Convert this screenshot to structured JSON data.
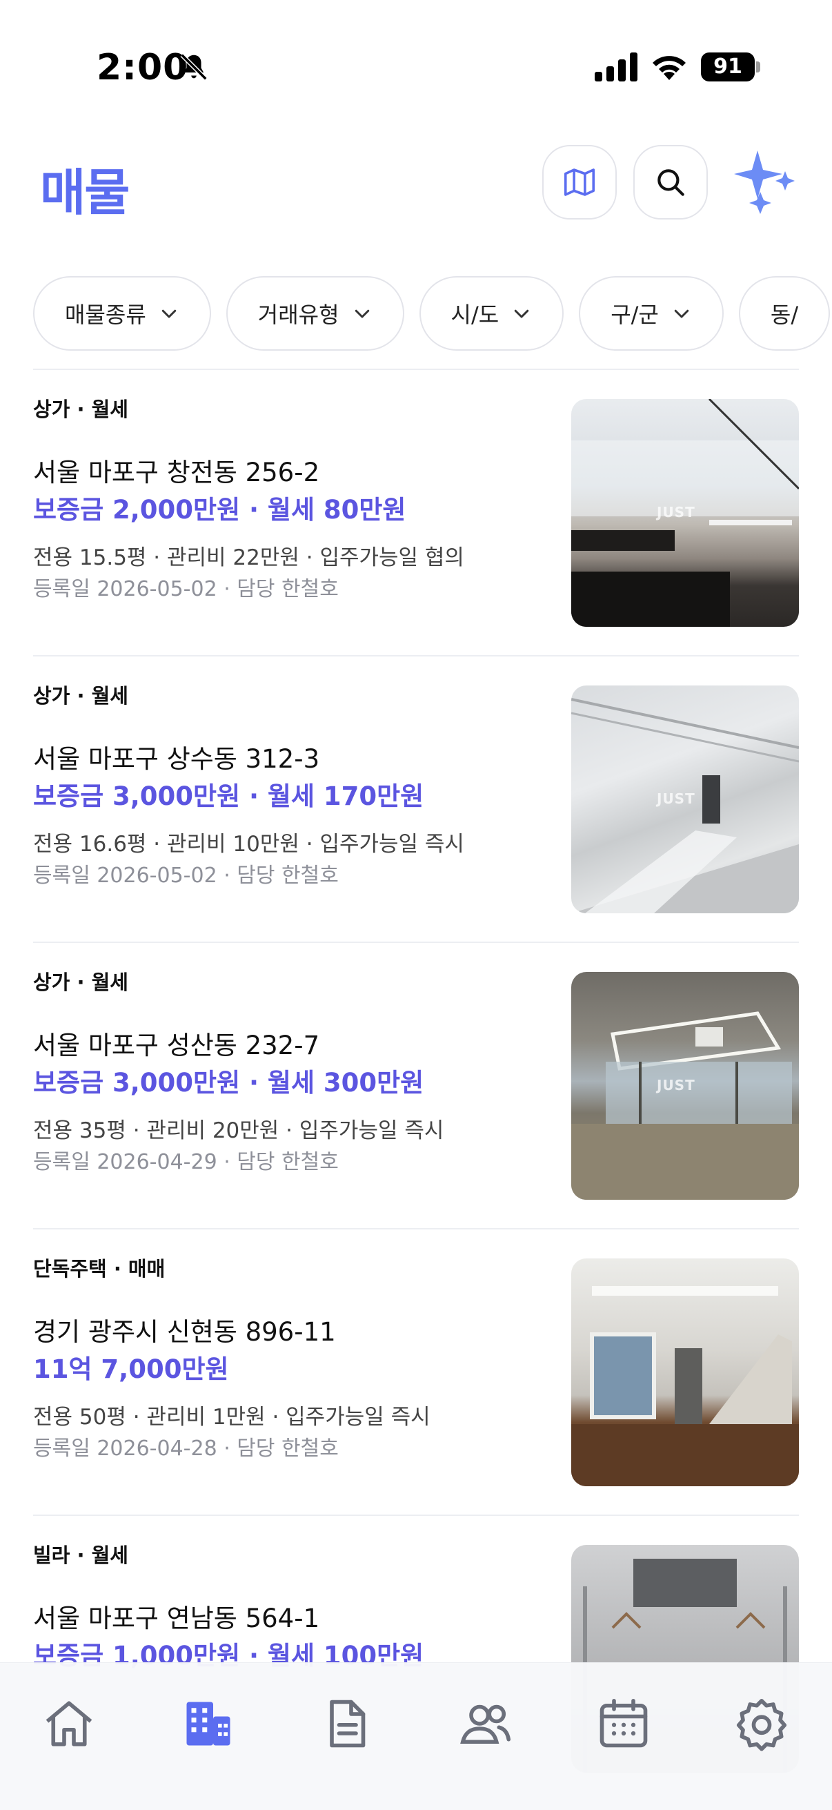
{
  "status_bar": {
    "time": "2:00",
    "battery": "91"
  },
  "header": {
    "title": "매물",
    "map_icon": "map-icon",
    "search_icon": "search-icon",
    "ai_icon": "sparkles-icon"
  },
  "filters": [
    {
      "label": "매물종류"
    },
    {
      "label": "거래유형"
    },
    {
      "label": "시/도"
    },
    {
      "label": "구/군"
    },
    {
      "label": "동/"
    }
  ],
  "listings": [
    {
      "type": "상가 · 월세",
      "address": "서울 마포구 창전동 256-2",
      "price": "보증금 2,000만원 · 월세 80만원",
      "meta": "전용 15.5평 · 관리비 22만원 · 입주가능일 협의",
      "registered": "등록일 2026-05-02 · 담당 한철호",
      "watermark": "JUST"
    },
    {
      "type": "상가 · 월세",
      "address": "서울 마포구 상수동 312-3",
      "price": "보증금 3,000만원 · 월세 170만원",
      "meta": "전용 16.6평 · 관리비 10만원 · 입주가능일 즉시",
      "registered": "등록일 2026-05-02 · 담당 한철호",
      "watermark": "JUST"
    },
    {
      "type": "상가 · 월세",
      "address": "서울 마포구 성산동 232-7",
      "price": "보증금 3,000만원 · 월세 300만원",
      "meta": "전용 35평 · 관리비 20만원 · 입주가능일 즉시",
      "registered": "등록일 2026-04-29 · 담당 한철호",
      "watermark": "JUST"
    },
    {
      "type": "단독주택 · 매매",
      "address": "경기 광주시 신현동 896-11",
      "price": "11억 7,000만원",
      "meta": "전용 50평 · 관리비 1만원 · 입주가능일 즉시",
      "registered": "등록일 2026-04-28 · 담당 한철호",
      "watermark": ""
    },
    {
      "type": "빌라 · 월세",
      "address": "서울 마포구 연남동 564-1",
      "price": "보증금 1,000만원 · 월세 100만원",
      "meta": "",
      "registered": "",
      "watermark": ""
    }
  ],
  "bottom_nav": [
    {
      "icon": "home-icon",
      "active": false
    },
    {
      "icon": "buildings-icon",
      "active": true
    },
    {
      "icon": "document-icon",
      "active": false
    },
    {
      "icon": "users-icon",
      "active": false
    },
    {
      "icon": "calendar-icon",
      "active": false
    },
    {
      "icon": "gear-icon",
      "active": false
    }
  ],
  "colors": {
    "accent": "#5b6df0",
    "price": "#5b55e0",
    "inactive_icon": "#6b6f7b"
  }
}
